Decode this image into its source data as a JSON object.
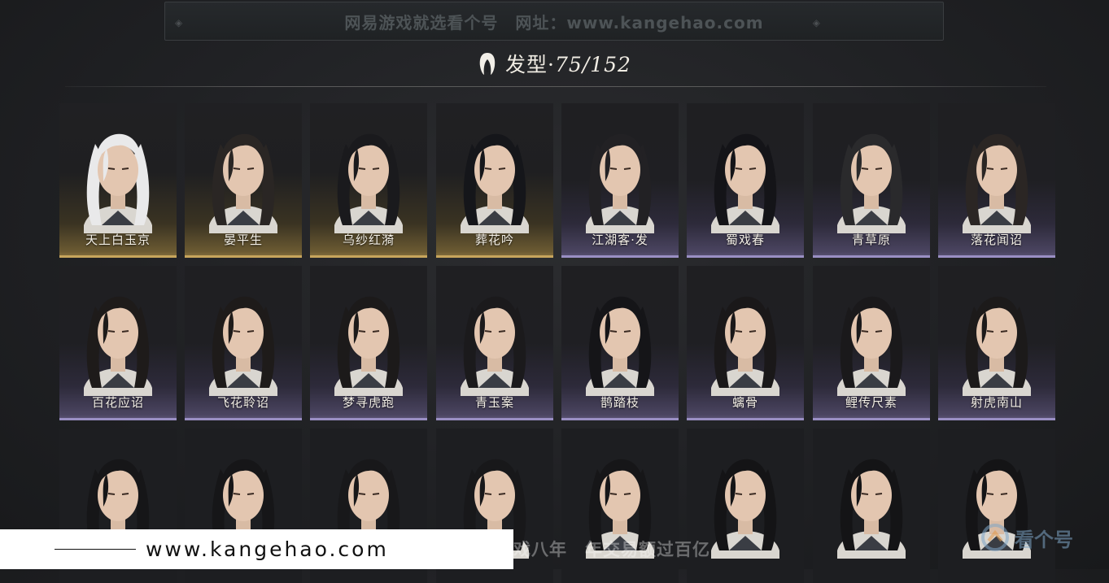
{
  "watermark_top": "网易游戏就选看个号　网址：www.kangehao.com",
  "header": {
    "title": "发型",
    "separator": "·",
    "count": "75/152"
  },
  "rows": [
    [
      {
        "label": "天上白玉京",
        "rarity": "gold",
        "hair": "#e9e9ea"
      },
      {
        "label": "晏平生",
        "rarity": "gold",
        "hair": "#2a2624"
      },
      {
        "label": "乌纱红漪",
        "rarity": "gold",
        "hair": "#1a1a1d"
      },
      {
        "label": "葬花吟",
        "rarity": "gold",
        "hair": "#15161a"
      },
      {
        "label": "江湖客·发",
        "rarity": "purple",
        "hair": "#222124"
      },
      {
        "label": "蜀戏春",
        "rarity": "purple",
        "hair": "#141418"
      },
      {
        "label": "青草原",
        "rarity": "purple",
        "hair": "#2a2a2c"
      },
      {
        "label": "落花闻诏",
        "rarity": "purple",
        "hair": "#2b2624"
      }
    ],
    [
      {
        "label": "百花应诏",
        "rarity": "purple",
        "hair": "#1e1b1a"
      },
      {
        "label": "飞花聆诏",
        "rarity": "purple",
        "hair": "#1e1b1a"
      },
      {
        "label": "梦寻虎跑",
        "rarity": "purple",
        "hair": "#1c1a1a"
      },
      {
        "label": "青玉案",
        "rarity": "purple",
        "hair": "#1b1a1c"
      },
      {
        "label": "鹊踏枝",
        "rarity": "purple",
        "hair": "#151518"
      },
      {
        "label": "螭骨",
        "rarity": "purple",
        "hair": "#1a1819"
      },
      {
        "label": "鲤传尺素",
        "rarity": "purple",
        "hair": "#1a191b"
      },
      {
        "label": "射虎南山",
        "rarity": "purple",
        "hair": "#1c1a1a"
      }
    ],
    [
      {
        "label": "",
        "rarity": "none",
        "hair": "#161618"
      },
      {
        "label": "",
        "rarity": "none",
        "hair": "#161618"
      },
      {
        "label": "",
        "rarity": "none",
        "hair": "#18181a"
      },
      {
        "label": "",
        "rarity": "none",
        "hair": "#18181a"
      },
      {
        "label": "",
        "rarity": "none",
        "hair": "#161618"
      },
      {
        "label": "",
        "rarity": "none",
        "hair": "#141416"
      },
      {
        "label": "",
        "rarity": "none",
        "hair": "#141416"
      },
      {
        "label": "",
        "rarity": "none",
        "hair": "#141416"
      }
    ]
  ],
  "watermark_bottom": {
    "url": "www.kangehao.com",
    "slogan": "看个号专业网易游戏八年　年交易额过百亿",
    "logo": "看个号"
  }
}
